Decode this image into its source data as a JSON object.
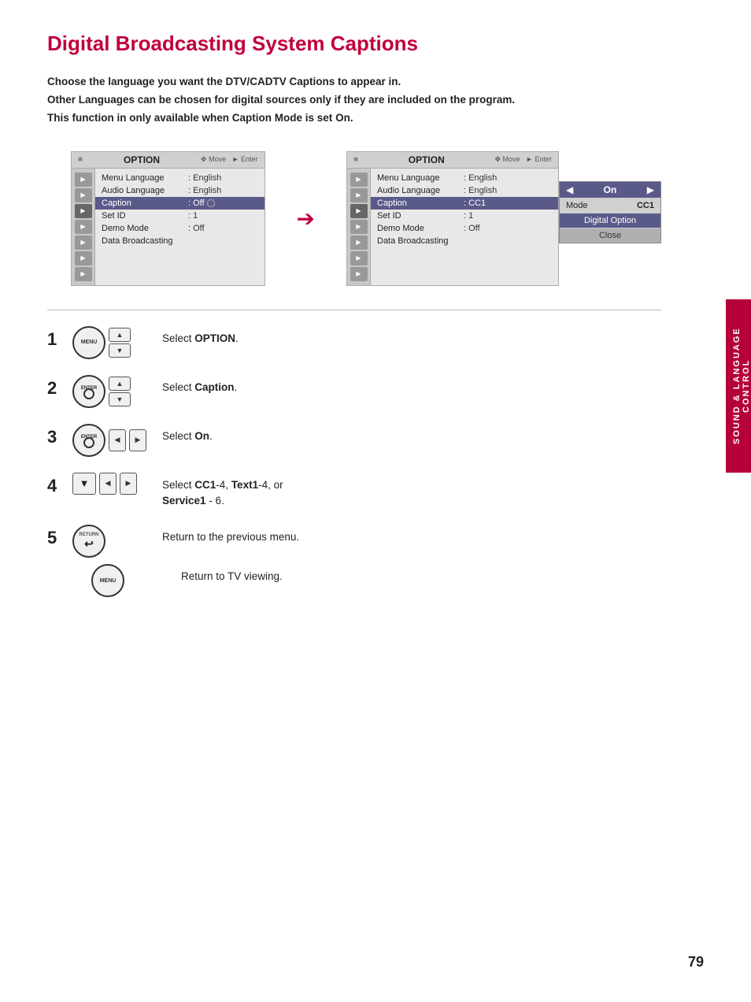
{
  "page": {
    "title": "Digital Broadcasting System Captions",
    "intro": [
      "Choose the language you want the DTV/CADTV Captions to appear in.",
      "Other Languages can be chosen for digital sources only if they are included on the program.",
      "This function in only available when Caption Mode is set On."
    ],
    "side_tab": "SOUND & LANGUAGE CONTROL",
    "page_number": "79"
  },
  "menu_left": {
    "title": "OPTION",
    "controls": "Move   Enter",
    "items": [
      {
        "label": "Menu Language",
        "value": ": English"
      },
      {
        "label": "Audio Language",
        "value": ": English"
      },
      {
        "label": "Caption",
        "value": ": Off",
        "highlighted": true,
        "has_circle": true
      },
      {
        "label": "Set ID",
        "value": ": 1"
      },
      {
        "label": "Demo Mode",
        "value": ": Off"
      },
      {
        "label": "Data Broadcasting",
        "value": ""
      }
    ]
  },
  "menu_right": {
    "title": "OPTION",
    "controls": "Move   Enter",
    "items": [
      {
        "label": "Menu Language",
        "value": ": English"
      },
      {
        "label": "Audio Language",
        "value": ": English"
      },
      {
        "label": "Caption",
        "value": ": CC1",
        "highlighted": true
      },
      {
        "label": "Set ID",
        "value": ": 1"
      },
      {
        "label": "Demo Mode",
        "value": ": Off"
      },
      {
        "label": "Data Broadcasting",
        "value": ""
      }
    ],
    "submenu": {
      "on_label": "On",
      "mode_label": "Mode",
      "cc1_label": "CC1",
      "digital_option_label": "Digital Option",
      "close_label": "Close"
    }
  },
  "steps": [
    {
      "number": "1",
      "icons": [
        "menu-circle",
        "up-down-arrows"
      ],
      "text": "Select ",
      "bold_text": "OPTION",
      "text_after": "."
    },
    {
      "number": "2",
      "icons": [
        "enter-circle",
        "up-down-arrows"
      ],
      "text": "Select ",
      "bold_text": "Caption",
      "text_after": "."
    },
    {
      "number": "3",
      "icons": [
        "enter-circle",
        "left-right-arrows"
      ],
      "text": "Select ",
      "bold_text": "On",
      "text_after": "."
    },
    {
      "number": "4",
      "icons": [
        "down-arrow",
        "left-right-arrows"
      ],
      "text": "Select ",
      "bold_text": "CC1",
      "text_bold2": "-4, ",
      "bold_text3": "Text1",
      "text_bold4": "-4, or",
      "newline": "Service1",
      "text_end": " - 6."
    },
    {
      "number": "5",
      "icons": [
        "return-circle"
      ],
      "text": "Return to the previous menu."
    },
    {
      "number": "5b",
      "icons": [
        "menu-circle2"
      ],
      "text": "Return to TV viewing."
    }
  ]
}
